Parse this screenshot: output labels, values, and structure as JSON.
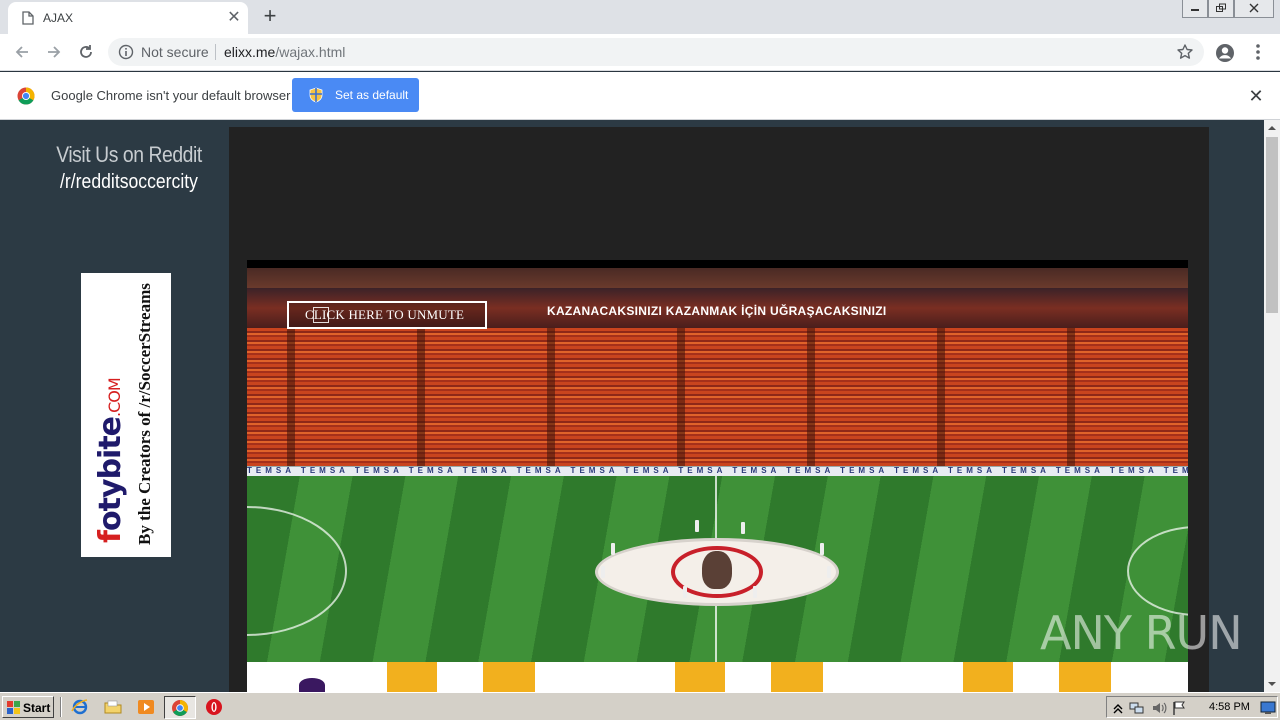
{
  "browser": {
    "tab": {
      "title": "AJAX"
    },
    "address": {
      "security_label": "Not secure",
      "url_host": "elixx.me",
      "url_path": "/wajax.html"
    },
    "infobar": {
      "message": "Google Chrome isn't your default browser",
      "button_label": "Set as default"
    }
  },
  "page": {
    "sidebar": {
      "title": "Visit Us on Reddit",
      "subreddit": "/r/redditsoccercity"
    },
    "ad": {
      "brand_lead": "f",
      "brand_rest": "otybite",
      "brand_suffix": ".COM",
      "tagline": "By the Creators of /r/SoccerStreams"
    },
    "player": {
      "unmute_label": "CLICK HERE TO UNMUTE",
      "ticker_text": "KAZANACAKSINIZI KAZANMAK İÇİN UĞRAŞACAKSINIZI",
      "adboard_text": "TEMSA TEMSA TEMSA TEMSA TEMSA TEMSA TEMSA TEMSA TEMSA TEMSA TEMSA TEMSA TEMSA TEMSA TEMSA TEMSA TEMSA TEMSA TEMSA TEMSA"
    },
    "watermark": "ANY RUN"
  },
  "taskbar": {
    "start_label": "Start",
    "clock": "4:58 PM"
  },
  "icons": {
    "tab": "page-icon",
    "nav": [
      "back-arrow-icon",
      "forward-arrow-icon",
      "reload-icon"
    ],
    "omnibox": [
      "info-icon",
      "star-icon"
    ],
    "toolbar_right": [
      "account-icon",
      "menu-dots-icon"
    ],
    "taskbar_quicklaunch": [
      "ie-icon",
      "folder-icon",
      "media-player-icon",
      "chrome-icon",
      "opera-icon"
    ],
    "tray": [
      "tray-arrow-icon",
      "network-icon",
      "volume-icon",
      "flag-icon",
      "monitor-icon"
    ]
  },
  "colors": {
    "accent_button": "#4a8af4",
    "page_background": "#2c3a44",
    "player_background": "#222222"
  }
}
